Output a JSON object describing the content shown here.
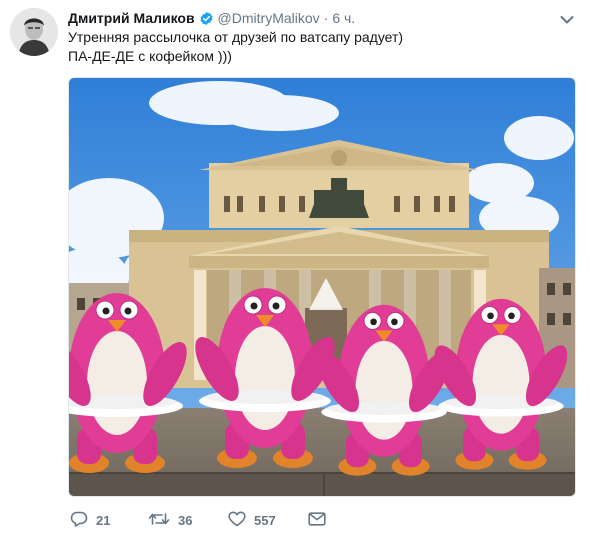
{
  "tweet": {
    "author": {
      "name": "Дмитрий Маликов",
      "handle": "@DmitryMalikov",
      "verified": true
    },
    "separator": "·",
    "time": "6 ч.",
    "text_lines": [
      "Утренняя рассылочка от друзей по ватсапу радует)",
      "ПА-ДЕ-ДЕ с кофейком )))"
    ],
    "media": {
      "icon": "photo"
    },
    "actions": {
      "replies": "21",
      "retweets": "36",
      "likes": "557"
    }
  },
  "colors": {
    "verified": "#1da1f2",
    "muted": "#657786",
    "penguin_pink": "#e23d96",
    "sky": "#3f8fe0"
  },
  "icons": {
    "reply": "reply-icon",
    "retweet": "retweet-icon",
    "like": "heart-icon",
    "message": "envelope-icon",
    "caret": "chevron-down-icon"
  }
}
